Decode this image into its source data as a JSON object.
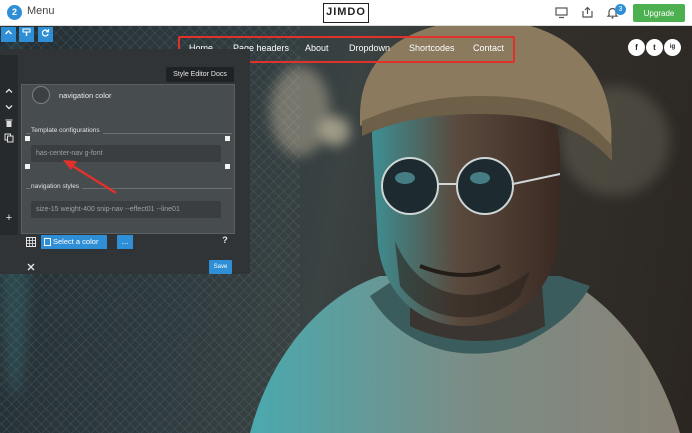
{
  "topbar": {
    "menu_count": "2",
    "menu_label": "Menu",
    "logo": "JIMDO",
    "notification_count": "3",
    "upgrade_label": "Upgrade"
  },
  "site_nav": {
    "items": [
      "Home",
      "Page headers",
      "About",
      "Dropdown",
      "Shortcodes",
      "Contact"
    ]
  },
  "social": [
    "f",
    "t",
    "ig"
  ],
  "editor": {
    "docs_tab": "Style Editor Docs",
    "nav_color_label": "navigation color",
    "template_config_label": "Template configurations",
    "template_config_value": "has-center-nav g-font",
    "nav_styles_label": "navigation styles",
    "nav_styles_value": "size-15 weight-400 snip-nav --effect01 --line01",
    "select_color_label": "Select a color",
    "more_label": "...",
    "help_label": "?",
    "save_label": "Save"
  },
  "colors": {
    "accent": "#2f8fd6",
    "upgrade": "#4caf50",
    "highlight": "#e0312b",
    "panel": "#303437"
  }
}
